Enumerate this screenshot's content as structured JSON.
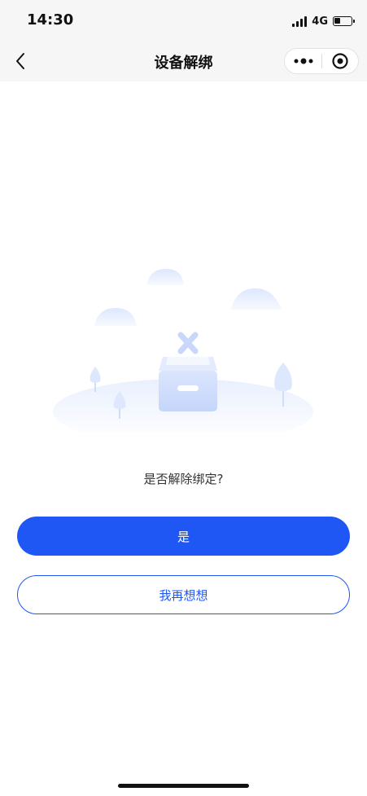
{
  "status_bar": {
    "time": "14:30",
    "network": "4G",
    "battery_level": 0.35
  },
  "nav": {
    "title": "设备解绑",
    "back_icon": "chevron-left-icon",
    "more_icon": "more-dots-icon",
    "close_icon": "target-circle-icon"
  },
  "main": {
    "question": "是否解除绑定?",
    "confirm_label": "是",
    "cancel_label": "我再想想"
  },
  "colors": {
    "accent": "#1f57f5",
    "nav_background": "#f6f6f6",
    "illustration_light": "#e6eefe"
  }
}
